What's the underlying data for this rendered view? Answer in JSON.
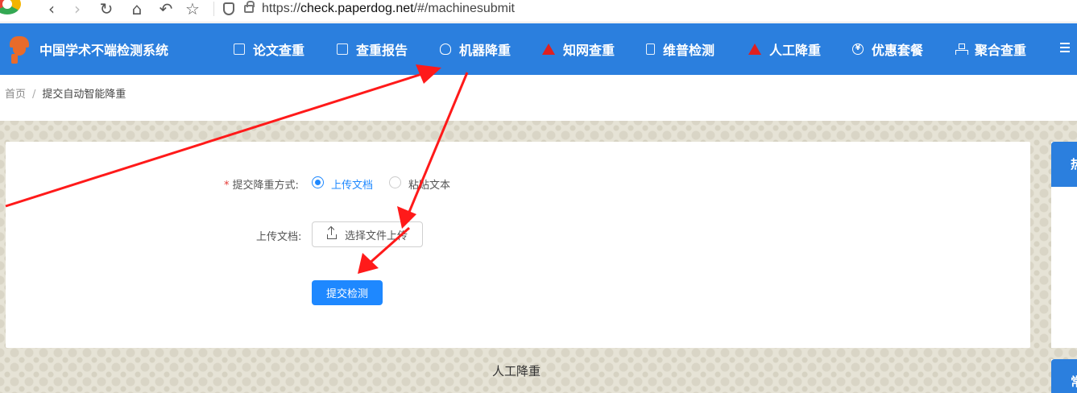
{
  "browser": {
    "url_scheme": "https://",
    "url_host": "check.paperdog.net",
    "url_path": "/#/machinesubmit"
  },
  "site": {
    "title": "中国学术不端检测系统"
  },
  "nav": {
    "items": [
      {
        "label": "论文查重",
        "icon": "document-search-icon"
      },
      {
        "label": "查重报告",
        "icon": "report-icon"
      },
      {
        "label": "机器降重",
        "icon": "robot-icon"
      },
      {
        "label": "知网查重",
        "icon": "cnki-icon"
      },
      {
        "label": "维普检测",
        "icon": "file-icon"
      },
      {
        "label": "人工降重",
        "icon": "cnki-icon"
      },
      {
        "label": "优惠套餐",
        "icon": "yen-icon"
      },
      {
        "label": "聚合查重",
        "icon": "tree-icon"
      }
    ]
  },
  "breadcrumb": {
    "home": "首页",
    "separator": "/",
    "current": "提交自动智能降重"
  },
  "form": {
    "method_label": "提交降重方式:",
    "method_required_mark": "*",
    "option_upload": "上传文档",
    "option_paste": "粘贴文本",
    "selected": "upload",
    "upload_label": "上传文档:",
    "upload_button": "选择文件上传",
    "submit_button": "提交检测"
  },
  "footer": {
    "section_title": "人工降重"
  },
  "sidebar": {
    "card1_head": "热",
    "card2_head": "常"
  },
  "colors": {
    "primary": "#2b7fde",
    "button": "#1e88ff",
    "annotation_arrow": "#ff1a1a",
    "required": "#e53935"
  }
}
